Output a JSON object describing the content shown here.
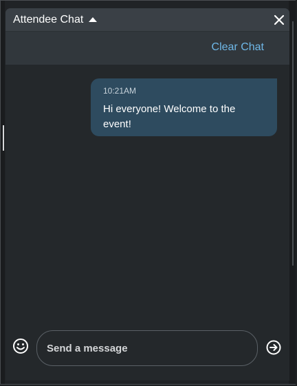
{
  "header": {
    "title": "Attendee Chat",
    "caret_icon": "caret-up-icon",
    "close_icon": "close-icon"
  },
  "toolbar": {
    "clear_label": "Clear Chat"
  },
  "messages": [
    {
      "time": "10:21AM",
      "text": "Hi everyone! Welcome to the event!"
    }
  ],
  "composer": {
    "placeholder": "Send a message",
    "emoji_icon": "emoji-smile-icon",
    "send_icon": "send-arrow-icon"
  },
  "colors": {
    "title_bar": "#3a4046",
    "action_bar": "#31373c",
    "body": "#24282b",
    "bubble": "#2e4b5f",
    "link": "#6fb8e8"
  }
}
